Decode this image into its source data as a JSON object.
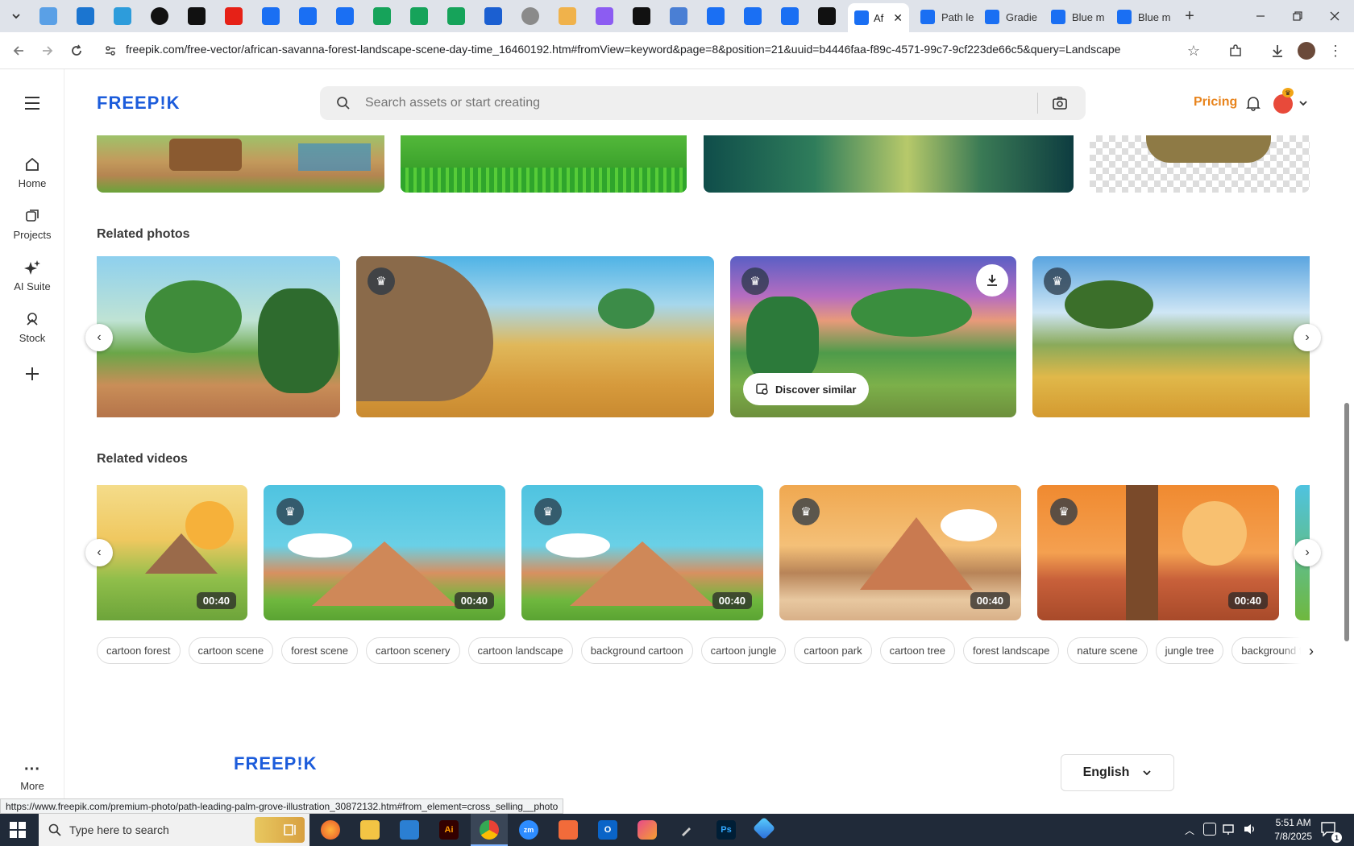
{
  "browser": {
    "active_tab_title": "Af",
    "tabs": [
      {
        "title": "Path le"
      },
      {
        "title": "Gradie"
      },
      {
        "title": "Blue m"
      },
      {
        "title": "Blue m"
      }
    ],
    "url": "freepik.com/free-vector/african-savanna-forest-landscape-scene-day-time_16460192.htm#fromView=keyword&page=8&position=21&uuid=b4446faa-f89c-4571-99c7-9cf223de66c5&query=Landscape",
    "new_tab": "+"
  },
  "site": {
    "logo": "FREEP!K",
    "search_placeholder": "Search assets or start creating",
    "pricing": "Pricing"
  },
  "rail": [
    {
      "label": "Home",
      "icon": "home-icon"
    },
    {
      "label": "Projects",
      "icon": "projects-icon"
    },
    {
      "label": "AI Suite",
      "icon": "sparkle-icon"
    },
    {
      "label": "Stock",
      "icon": "stock-icon"
    },
    {
      "label": "More",
      "icon": "more-icon"
    }
  ],
  "sections": {
    "photos_title": "Related photos",
    "videos_title": "Related videos",
    "discover_similar": "Discover similar"
  },
  "videos": [
    {
      "duration": "00:40"
    },
    {
      "duration": "00:40"
    },
    {
      "duration": "00:40"
    },
    {
      "duration": "00:40"
    },
    {
      "duration": "00:40"
    }
  ],
  "tags": [
    "cartoon forest",
    "cartoon scene",
    "forest scene",
    "cartoon scenery",
    "cartoon landscape",
    "background cartoon",
    "cartoon jungle",
    "cartoon park",
    "cartoon tree",
    "forest landscape",
    "nature scene",
    "jungle tree",
    "background fore"
  ],
  "footer": {
    "logo": "FREEP!K",
    "language": "English"
  },
  "status_url": "https://www.freepik.com/premium-photo/path-leading-palm-grove-illustration_30872132.htm#from_element=cross_selling__photo",
  "taskbar": {
    "search_placeholder": "Type here to search",
    "time": "5:51 AM",
    "date": "7/8/2025",
    "notification_count": "1"
  },
  "colors": {
    "brand": "#1c5cdb",
    "pricing": "#e8841d",
    "taskbar": "#202a39"
  }
}
